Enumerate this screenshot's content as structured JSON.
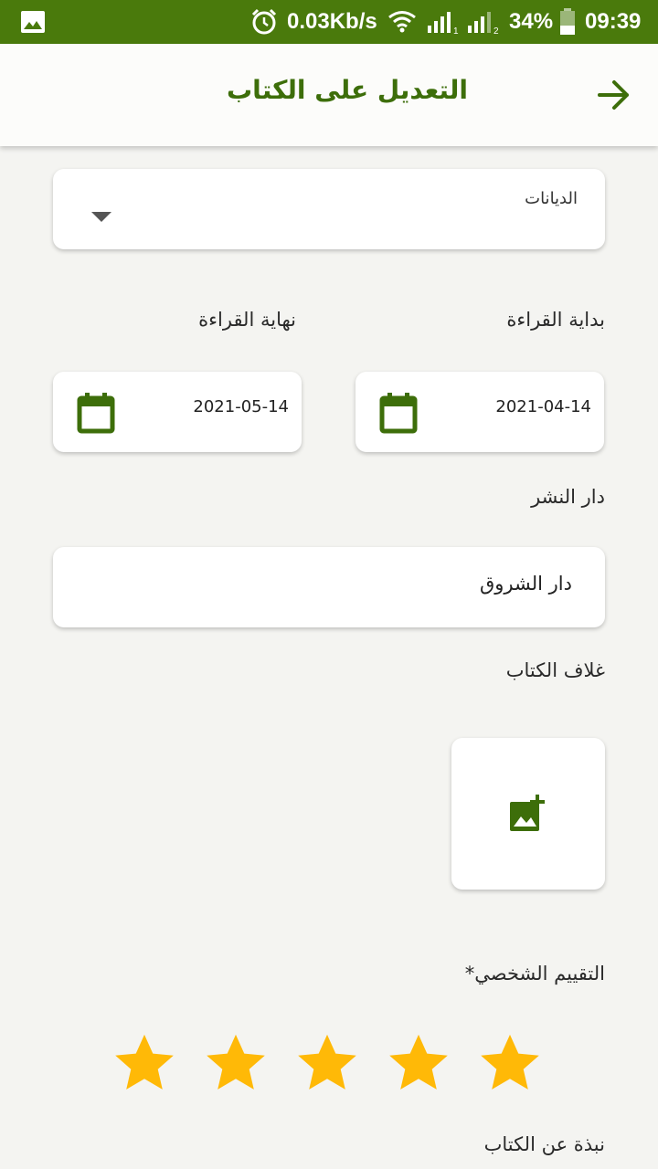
{
  "status_bar": {
    "net_speed": "0.03Kb/s",
    "battery": "34%",
    "time": "09:39",
    "sim1": "1",
    "sim2": "2",
    "icons": [
      "gallery-icon",
      "alarm-icon",
      "wifi-icon",
      "signal-icon",
      "battery-icon"
    ]
  },
  "app_bar": {
    "title": "التعديل على الكتاب",
    "back_icon": "arrow-right-icon"
  },
  "form": {
    "category": {
      "label": "الديانات",
      "icon": "dropdown-arrow-icon"
    },
    "start_reading": {
      "label": "بداية القراءة",
      "value": "2021-04-14",
      "icon": "calendar-icon"
    },
    "end_reading": {
      "label": "نهاية القراءة",
      "value": "2021-05-14",
      "icon": "calendar-icon"
    },
    "publisher": {
      "label": "دار النشر",
      "value": "دار الشروق"
    },
    "cover": {
      "label": "غلاف الكتاب",
      "icon": "add-photo-icon"
    },
    "rating": {
      "label": "التقييم الشخصي*",
      "value": 5,
      "max": 5
    },
    "summary": {
      "label": "نبذة عن الكتاب"
    }
  },
  "colors": {
    "primary": "#4a7a0c",
    "title": "#3d6e0a",
    "star": "#ffb907",
    "background": "#f4f4f1"
  }
}
